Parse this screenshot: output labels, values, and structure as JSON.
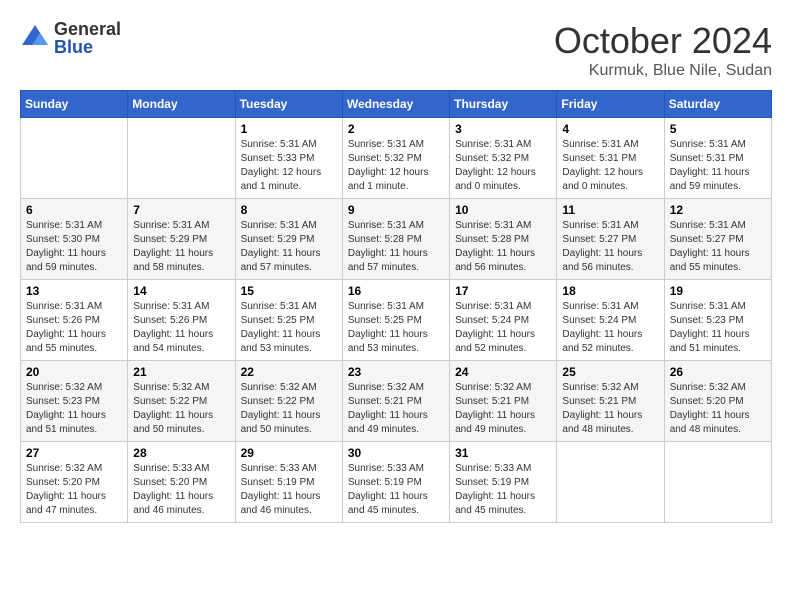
{
  "logo": {
    "general": "General",
    "blue": "Blue"
  },
  "header": {
    "month": "October 2024",
    "location": "Kurmuk, Blue Nile, Sudan"
  },
  "weekdays": [
    "Sunday",
    "Monday",
    "Tuesday",
    "Wednesday",
    "Thursday",
    "Friday",
    "Saturday"
  ],
  "weeks": [
    [
      {
        "day": "",
        "sunrise": "",
        "sunset": "",
        "daylight": ""
      },
      {
        "day": "",
        "sunrise": "",
        "sunset": "",
        "daylight": ""
      },
      {
        "day": "1",
        "sunrise": "Sunrise: 5:31 AM",
        "sunset": "Sunset: 5:33 PM",
        "daylight": "Daylight: 12 hours and 1 minute."
      },
      {
        "day": "2",
        "sunrise": "Sunrise: 5:31 AM",
        "sunset": "Sunset: 5:32 PM",
        "daylight": "Daylight: 12 hours and 1 minute."
      },
      {
        "day": "3",
        "sunrise": "Sunrise: 5:31 AM",
        "sunset": "Sunset: 5:32 PM",
        "daylight": "Daylight: 12 hours and 0 minutes."
      },
      {
        "day": "4",
        "sunrise": "Sunrise: 5:31 AM",
        "sunset": "Sunset: 5:31 PM",
        "daylight": "Daylight: 12 hours and 0 minutes."
      },
      {
        "day": "5",
        "sunrise": "Sunrise: 5:31 AM",
        "sunset": "Sunset: 5:31 PM",
        "daylight": "Daylight: 11 hours and 59 minutes."
      }
    ],
    [
      {
        "day": "6",
        "sunrise": "Sunrise: 5:31 AM",
        "sunset": "Sunset: 5:30 PM",
        "daylight": "Daylight: 11 hours and 59 minutes."
      },
      {
        "day": "7",
        "sunrise": "Sunrise: 5:31 AM",
        "sunset": "Sunset: 5:29 PM",
        "daylight": "Daylight: 11 hours and 58 minutes."
      },
      {
        "day": "8",
        "sunrise": "Sunrise: 5:31 AM",
        "sunset": "Sunset: 5:29 PM",
        "daylight": "Daylight: 11 hours and 57 minutes."
      },
      {
        "day": "9",
        "sunrise": "Sunrise: 5:31 AM",
        "sunset": "Sunset: 5:28 PM",
        "daylight": "Daylight: 11 hours and 57 minutes."
      },
      {
        "day": "10",
        "sunrise": "Sunrise: 5:31 AM",
        "sunset": "Sunset: 5:28 PM",
        "daylight": "Daylight: 11 hours and 56 minutes."
      },
      {
        "day": "11",
        "sunrise": "Sunrise: 5:31 AM",
        "sunset": "Sunset: 5:27 PM",
        "daylight": "Daylight: 11 hours and 56 minutes."
      },
      {
        "day": "12",
        "sunrise": "Sunrise: 5:31 AM",
        "sunset": "Sunset: 5:27 PM",
        "daylight": "Daylight: 11 hours and 55 minutes."
      }
    ],
    [
      {
        "day": "13",
        "sunrise": "Sunrise: 5:31 AM",
        "sunset": "Sunset: 5:26 PM",
        "daylight": "Daylight: 11 hours and 55 minutes."
      },
      {
        "day": "14",
        "sunrise": "Sunrise: 5:31 AM",
        "sunset": "Sunset: 5:26 PM",
        "daylight": "Daylight: 11 hours and 54 minutes."
      },
      {
        "day": "15",
        "sunrise": "Sunrise: 5:31 AM",
        "sunset": "Sunset: 5:25 PM",
        "daylight": "Daylight: 11 hours and 53 minutes."
      },
      {
        "day": "16",
        "sunrise": "Sunrise: 5:31 AM",
        "sunset": "Sunset: 5:25 PM",
        "daylight": "Daylight: 11 hours and 53 minutes."
      },
      {
        "day": "17",
        "sunrise": "Sunrise: 5:31 AM",
        "sunset": "Sunset: 5:24 PM",
        "daylight": "Daylight: 11 hours and 52 minutes."
      },
      {
        "day": "18",
        "sunrise": "Sunrise: 5:31 AM",
        "sunset": "Sunset: 5:24 PM",
        "daylight": "Daylight: 11 hours and 52 minutes."
      },
      {
        "day": "19",
        "sunrise": "Sunrise: 5:31 AM",
        "sunset": "Sunset: 5:23 PM",
        "daylight": "Daylight: 11 hours and 51 minutes."
      }
    ],
    [
      {
        "day": "20",
        "sunrise": "Sunrise: 5:32 AM",
        "sunset": "Sunset: 5:23 PM",
        "daylight": "Daylight: 11 hours and 51 minutes."
      },
      {
        "day": "21",
        "sunrise": "Sunrise: 5:32 AM",
        "sunset": "Sunset: 5:22 PM",
        "daylight": "Daylight: 11 hours and 50 minutes."
      },
      {
        "day": "22",
        "sunrise": "Sunrise: 5:32 AM",
        "sunset": "Sunset: 5:22 PM",
        "daylight": "Daylight: 11 hours and 50 minutes."
      },
      {
        "day": "23",
        "sunrise": "Sunrise: 5:32 AM",
        "sunset": "Sunset: 5:21 PM",
        "daylight": "Daylight: 11 hours and 49 minutes."
      },
      {
        "day": "24",
        "sunrise": "Sunrise: 5:32 AM",
        "sunset": "Sunset: 5:21 PM",
        "daylight": "Daylight: 11 hours and 49 minutes."
      },
      {
        "day": "25",
        "sunrise": "Sunrise: 5:32 AM",
        "sunset": "Sunset: 5:21 PM",
        "daylight": "Daylight: 11 hours and 48 minutes."
      },
      {
        "day": "26",
        "sunrise": "Sunrise: 5:32 AM",
        "sunset": "Sunset: 5:20 PM",
        "daylight": "Daylight: 11 hours and 48 minutes."
      }
    ],
    [
      {
        "day": "27",
        "sunrise": "Sunrise: 5:32 AM",
        "sunset": "Sunset: 5:20 PM",
        "daylight": "Daylight: 11 hours and 47 minutes."
      },
      {
        "day": "28",
        "sunrise": "Sunrise: 5:33 AM",
        "sunset": "Sunset: 5:20 PM",
        "daylight": "Daylight: 11 hours and 46 minutes."
      },
      {
        "day": "29",
        "sunrise": "Sunrise: 5:33 AM",
        "sunset": "Sunset: 5:19 PM",
        "daylight": "Daylight: 11 hours and 46 minutes."
      },
      {
        "day": "30",
        "sunrise": "Sunrise: 5:33 AM",
        "sunset": "Sunset: 5:19 PM",
        "daylight": "Daylight: 11 hours and 45 minutes."
      },
      {
        "day": "31",
        "sunrise": "Sunrise: 5:33 AM",
        "sunset": "Sunset: 5:19 PM",
        "daylight": "Daylight: 11 hours and 45 minutes."
      },
      {
        "day": "",
        "sunrise": "",
        "sunset": "",
        "daylight": ""
      },
      {
        "day": "",
        "sunrise": "",
        "sunset": "",
        "daylight": ""
      }
    ]
  ]
}
